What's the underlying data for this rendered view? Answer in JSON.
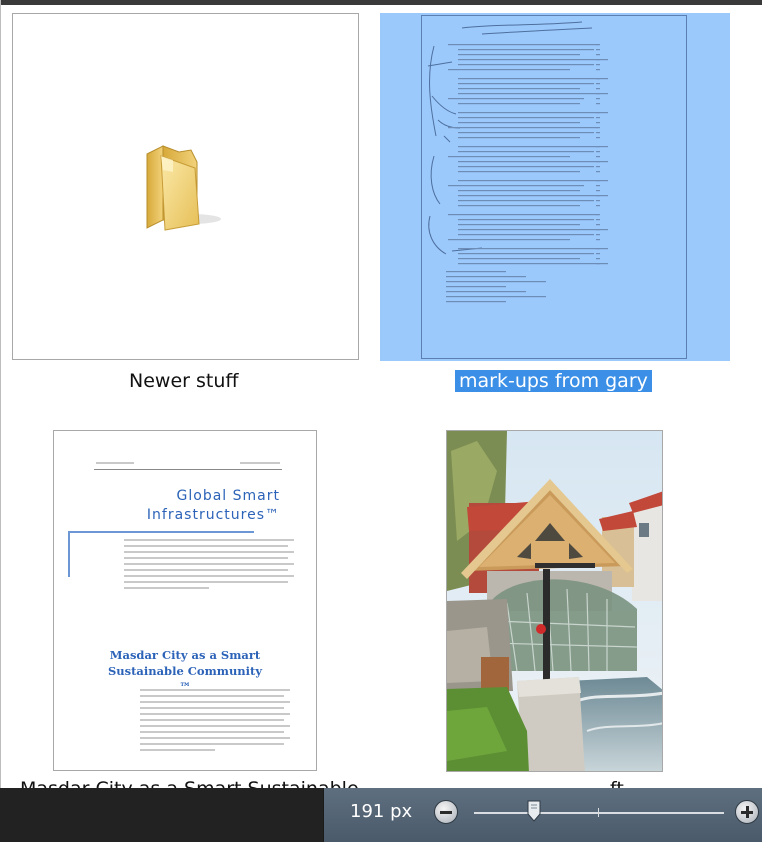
{
  "items": [
    {
      "label": "Newer stuff",
      "type": "folder",
      "selected": false
    },
    {
      "label": "mark-ups from gary",
      "type": "document-scan",
      "selected": true
    },
    {
      "label": "Masdar City as a Smart Sustainable ...",
      "type": "document",
      "selected": false,
      "doc_title": "Global Smart Infrastructures™",
      "doc_subtitle": "Masdar City as a Smart Sustainable Community ™"
    },
    {
      "label": "...ft",
      "type": "photo",
      "selected": false
    }
  ],
  "partial_caption_text": "Masdar City as a Smart Sustainable ...            ...ft",
  "status_bar": {
    "zoom_label": "191 px",
    "zoom_fraction": 0.24
  },
  "icons": [
    "folder-icon",
    "zoom-out-icon",
    "zoom-in-icon",
    "slider-thumb-icon"
  ],
  "colors": {
    "selection_bg": "#9cc9fb",
    "label_highlight": "#3b8fe6",
    "status_bar": "#4f6070",
    "doc_blue": "#2c63b8"
  }
}
